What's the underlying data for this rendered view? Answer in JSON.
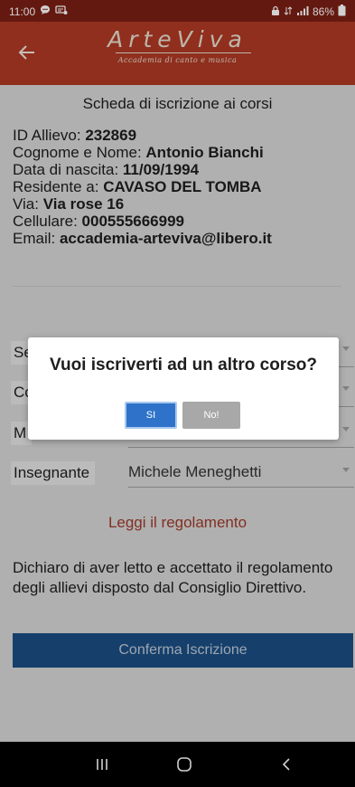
{
  "status_bar": {
    "time": "11:00",
    "battery": "86%"
  },
  "header": {
    "logo_title": "ArteViva",
    "logo_subtitle": "Accademia di canto e musica"
  },
  "form": {
    "title": "Scheda di iscrizione ai corsi",
    "student_id": {
      "label": "ID Allievo: ",
      "value": "232869"
    },
    "full_name": {
      "label": "Cognome e Nome: ",
      "value": "Antonio Bianchi"
    },
    "birth_date": {
      "label": "Data di nascita: ",
      "value": "11/09/1994"
    },
    "residence": {
      "label": "Residente a: ",
      "value": "CAVASO DEL TOMBA"
    },
    "street": {
      "label": "Via: ",
      "value": "Via rose 16"
    },
    "mobile": {
      "label": "Cellulare: ",
      "value": "000555666999"
    },
    "email": {
      "label": "Email: ",
      "value": "accademia-arteviva@libero.it"
    },
    "fields": [
      {
        "label": "Se",
        "value": ""
      },
      {
        "label": "Co",
        "value": ""
      },
      {
        "label": "M",
        "value": ""
      },
      {
        "label": "Insegnante",
        "value": "Michele Meneghetti"
      }
    ],
    "rules_link": "Leggi il regolamento",
    "declaration": "Dichiaro di aver letto e accettato il regolamento degli allievi disposto dal Consiglio Direttivo.",
    "confirm_button": "Conferma Iscrizione"
  },
  "dialog": {
    "title": "Vuoi iscriverti ad un altro corso?",
    "yes": "SI",
    "no": "No!"
  },
  "colors": {
    "primary": "#b03a25",
    "status_bar": "#7a1f14",
    "confirm": "#1b4f83",
    "link": "#a03a2a",
    "dialog_yes": "#2e73c9"
  }
}
